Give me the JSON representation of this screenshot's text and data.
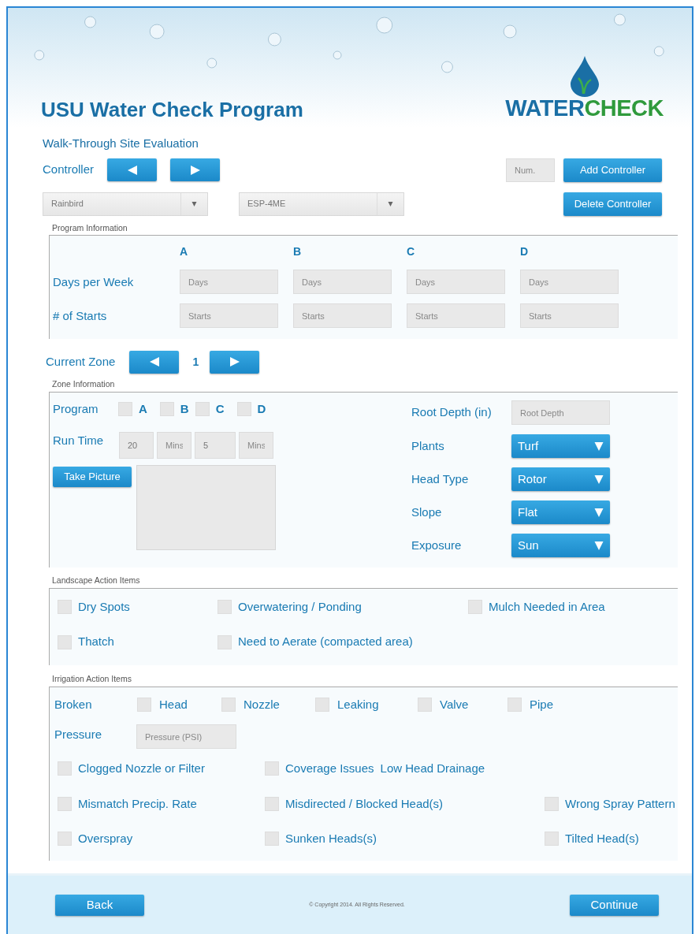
{
  "header": {
    "title": "USU Water Check Program",
    "logo": {
      "water": "WATER",
      "check": "CHECK"
    }
  },
  "subtitle": "Walk-Through Site Evaluation",
  "controller": {
    "label": "Controller",
    "num_placeholder": "Num.",
    "add_button": "Add Controller",
    "delete_button": "Delete Controller",
    "brand": "Rainbird",
    "model": "ESP-4ME"
  },
  "program_information": {
    "title": "Program Information",
    "programs": [
      "A",
      "B",
      "C",
      "D"
    ],
    "rows": [
      {
        "label": "Days per Week",
        "placeholders": [
          "Days",
          "Days",
          "Days",
          "Days"
        ]
      },
      {
        "label": "# of Starts",
        "placeholders": [
          "Starts",
          "Starts",
          "Starts",
          "Starts"
        ]
      }
    ]
  },
  "current_zone": {
    "label": "Current Zone",
    "value": "1"
  },
  "zone_information": {
    "title": "Zone Information",
    "program": {
      "label": "Program",
      "options": [
        {
          "label": "A",
          "checked": false
        },
        {
          "label": "B",
          "checked": false
        },
        {
          "label": "C",
          "checked": false
        },
        {
          "label": "D",
          "checked": false
        }
      ]
    },
    "run_time": {
      "label": "Run Time",
      "fields": [
        {
          "value": "20"
        },
        {
          "placeholder": "Mins"
        },
        {
          "value": "5"
        },
        {
          "placeholder": "Mins"
        }
      ]
    },
    "take_picture": "Take Picture",
    "root_depth": {
      "label": "Root Depth (in)",
      "placeholder": "Root Depth"
    },
    "dropdowns": [
      {
        "label": "Plants",
        "value": "Turf"
      },
      {
        "label": "Head Type",
        "value": "Rotor"
      },
      {
        "label": "Slope",
        "value": "Flat"
      },
      {
        "label": "Exposure",
        "value": "Sun"
      }
    ]
  },
  "landscape_action_items": {
    "title": "Landscape Action Items",
    "rows": [
      [
        {
          "label": "Dry Spots",
          "checked": false
        },
        {
          "label": "Overwatering / Ponding",
          "checked": false
        },
        {
          "label": "Mulch Needed in Area",
          "checked": false
        }
      ],
      [
        {
          "label": "Thatch",
          "checked": false
        },
        {
          "label": "Need to Aerate (compacted area)",
          "checked": false
        }
      ]
    ]
  },
  "irrigation_action_items": {
    "title": "Irrigation Action Items",
    "broken": {
      "label": "Broken",
      "items": [
        {
          "label": "Head",
          "checked": false
        },
        {
          "label": "Nozzle",
          "checked": false
        },
        {
          "label": "Leaking",
          "checked": false
        },
        {
          "label": "Valve",
          "checked": false
        },
        {
          "label": "Pipe",
          "checked": false
        }
      ]
    },
    "pressure": {
      "label": "Pressure",
      "placeholder": "Pressure (PSI)"
    },
    "rows": [
      [
        {
          "label": "Clogged Nozzle or Filter",
          "checked": false
        },
        {
          "label": "Coverage Issues",
          "extra_label": "Low Head Drainage",
          "checked": false
        }
      ],
      [
        {
          "label": "Mismatch Precip. Rate",
          "checked": false
        },
        {
          "label": "Misdirected / Blocked Head(s)",
          "checked": false
        },
        {
          "label": "Wrong Spray Pattern",
          "checked": false
        }
      ],
      [
        {
          "label": "Overspray",
          "checked": false
        },
        {
          "label": "Sunken Heads(s)",
          "checked": false
        },
        {
          "label": "Tilted Head(s)",
          "checked": false
        }
      ]
    ]
  },
  "footer": {
    "back_button": "Back",
    "copyright": "© Copyright 2014. All Rights Reserved.",
    "continue_button": "Continue"
  }
}
